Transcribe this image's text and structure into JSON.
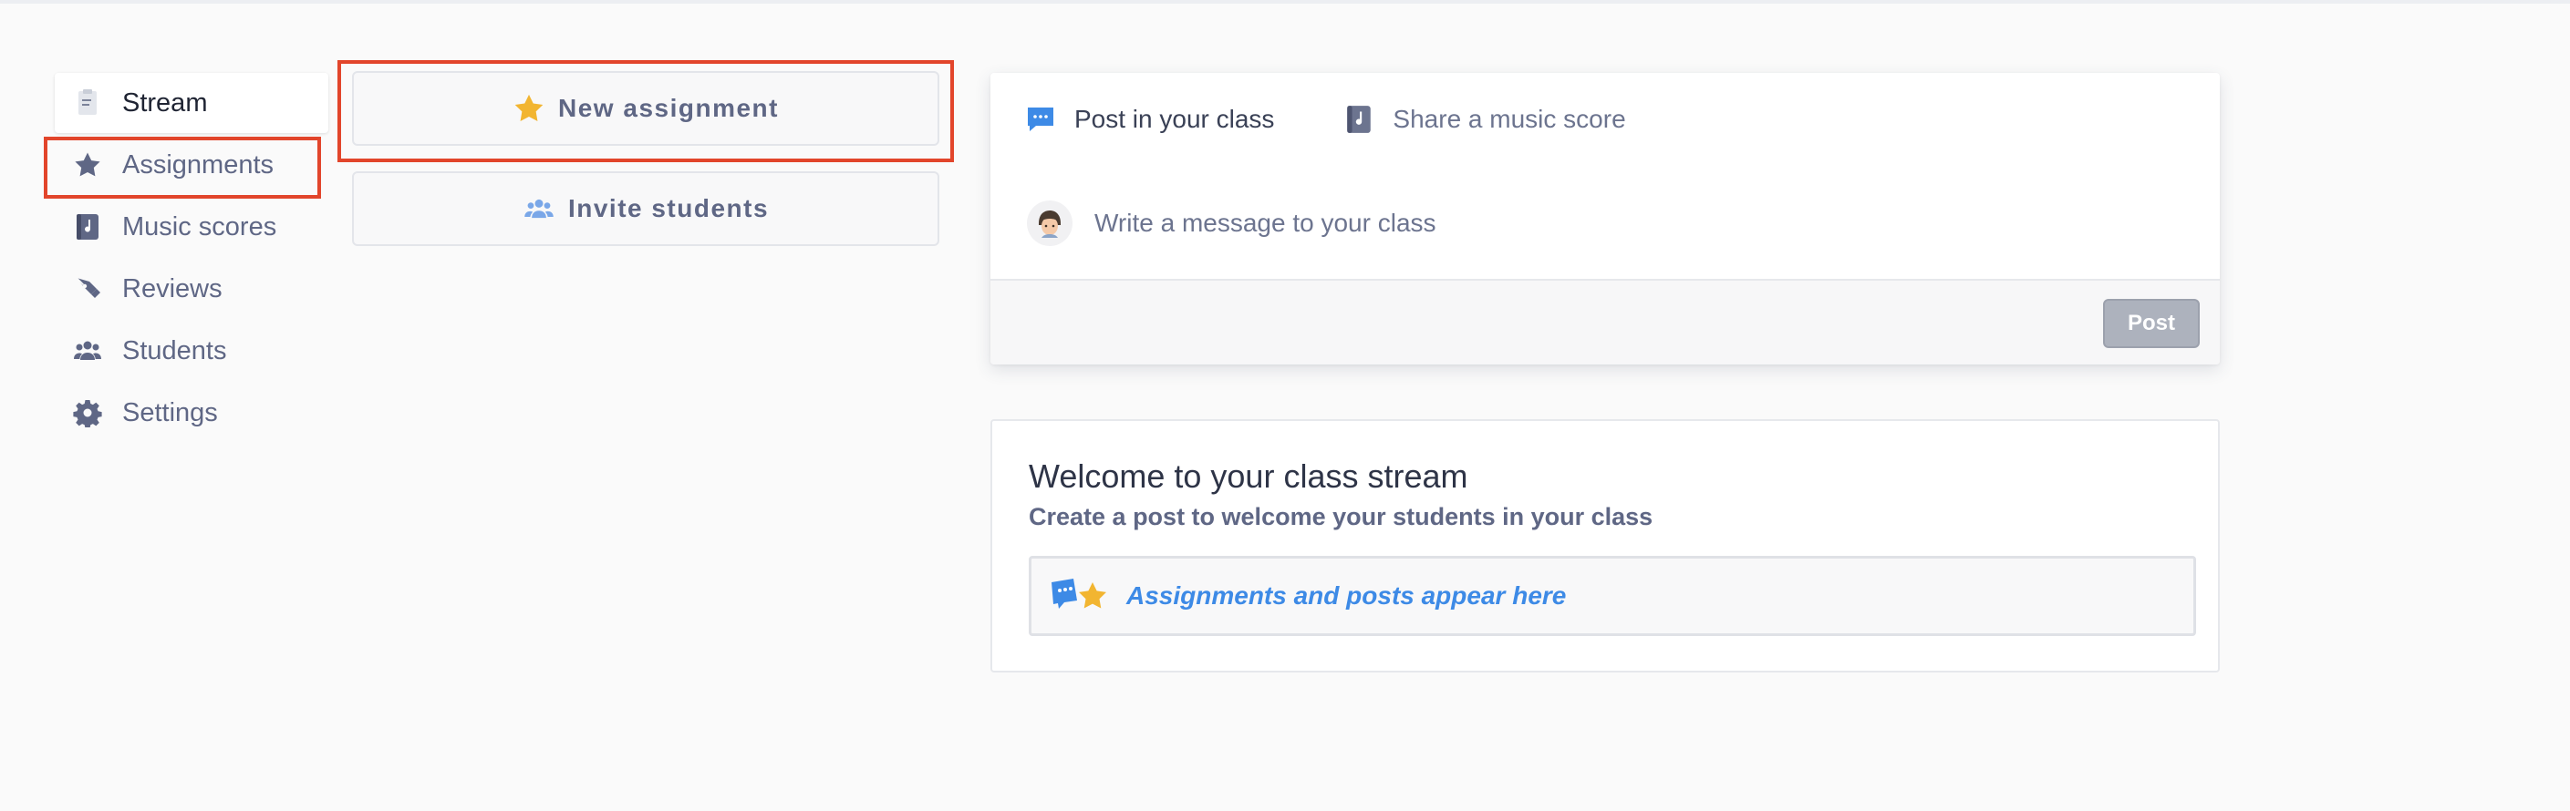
{
  "sidebar": {
    "items": [
      {
        "label": "Stream",
        "icon": "document-icon",
        "active": true
      },
      {
        "label": "Assignments",
        "icon": "star-icon",
        "active": false
      },
      {
        "label": "Music scores",
        "icon": "music-book-icon",
        "active": false
      },
      {
        "label": "Reviews",
        "icon": "pen-nib-icon",
        "active": false
      },
      {
        "label": "Students",
        "icon": "people-icon",
        "active": false
      },
      {
        "label": "Settings",
        "icon": "gear-icon",
        "active": false
      }
    ]
  },
  "actions": {
    "new_assignment": "New assignment",
    "invite_students": "Invite students"
  },
  "composer": {
    "tabs": [
      {
        "label": "Post in your class",
        "icon": "chat-bubble-icon",
        "active": true
      },
      {
        "label": "Share a music score",
        "icon": "music-book-icon",
        "active": false
      }
    ],
    "message_placeholder": "Write a message to your class",
    "post_label": "Post"
  },
  "welcome": {
    "title": "Welcome to your class stream",
    "subtitle": "Create a post to welcome your students in your class",
    "banner_text": "Assignments and posts appear here"
  },
  "colors": {
    "highlight_box": "#e2452b",
    "accent_blue": "#3d8ae6",
    "star_yellow": "#f2b531",
    "icon_slate": "#5f6785"
  }
}
